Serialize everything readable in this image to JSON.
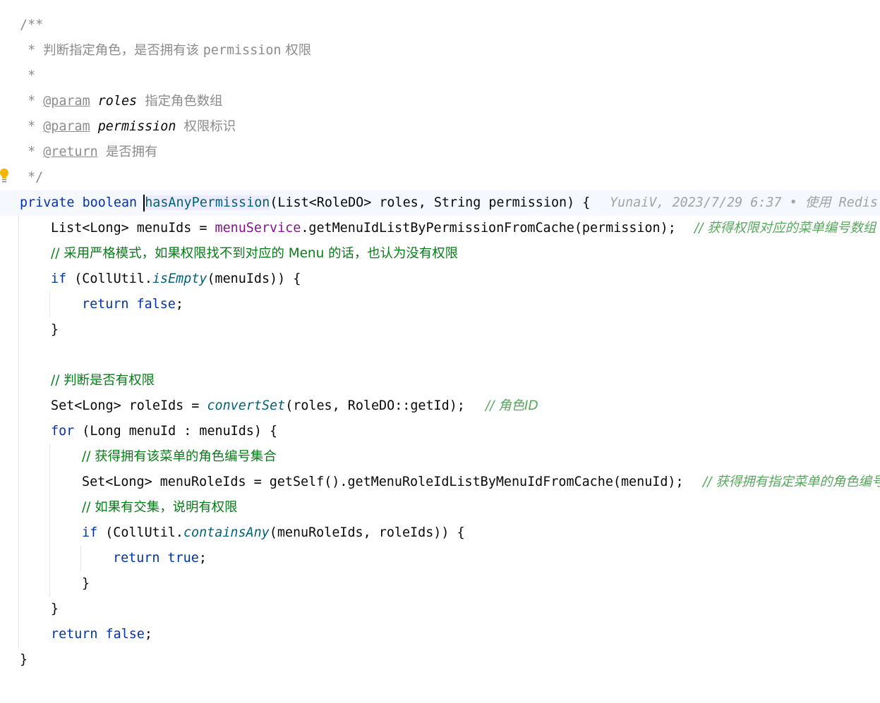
{
  "doc": {
    "l1": "/**",
    "l2_star": " * ",
    "l2_text": "判断指定角色，是否拥有该 ",
    "l2_perm": "permission",
    "l2_tail": " 权限",
    "l3": " *",
    "l4_star": " * ",
    "l4_tag": "@param",
    "l4_name": "roles",
    "l4_desc": "指定角色数组",
    "l5_star": " * ",
    "l5_tag": "@param",
    "l5_name": "permission",
    "l5_desc": "权限标识",
    "l6_star": " * ",
    "l6_tag": "@return",
    "l6_desc": "是否拥有",
    "l7": " */"
  },
  "sig": {
    "private": "private",
    "boolean": "boolean",
    "name": "hasAnyPermission",
    "params": "(List<RoleDO> roles, String permission) {",
    "inlay": "YunaiV, 2023/7/29 6:37 • 使用 Redis"
  },
  "body": {
    "l9_a": "List<Long> menuIds = ",
    "l9_field": "menuService",
    "l9_b": ".getMenuIdListByPermissionFromCache(permission);",
    "l9_comment": "// 获得权限对应的菜单编号数组",
    "l10_comment": "// 采用严格模式，如果权限找不到对应的 Menu 的话，也认为没有权限",
    "l11_if": "if",
    "l11_a": " (CollUtil.",
    "l11_m": "isEmpty",
    "l11_b": "(menuIds)) {",
    "l12_ret": "return",
    "l12_val": "false",
    "l12_end": ";",
    "l13": "}",
    "l15_comment": "// 判断是否有权限",
    "l16_a": "Set<Long> roleIds = ",
    "l16_m": "convertSet",
    "l16_b": "(roles, RoleDO::getId);",
    "l16_comment": "// 角色ID",
    "l17_for": "for",
    "l17_a": " (Long menuId : menuIds) {",
    "l18_comment": "// 获得拥有该菜单的角色编号集合",
    "l19_a": "Set<Long> menuRoleIds = getSelf().getMenuRoleIdListByMenuIdFromCache(menuId);",
    "l19_comment": "// 获得拥有指定菜单的角色编号数组",
    "l20_comment": "// 如果有交集，说明有权限",
    "l21_if": "if",
    "l21_a": " (CollUtil.",
    "l21_m": "containsAny",
    "l21_b": "(menuRoleIds, roleIds)) {",
    "l22_ret": "return",
    "l22_val": "true",
    "l22_end": ";",
    "l23": "}",
    "l24": "}",
    "l25_ret": "return",
    "l25_val": "false",
    "l25_end": ";",
    "l26": "}"
  },
  "colors": {
    "keyword": "#0033b3",
    "field": "#871094",
    "static_method": "#00627a",
    "line_comment": "#067d17",
    "doc_comment": "#8c8c8c"
  },
  "icons": {
    "gutter": "lightbulb-icon"
  }
}
